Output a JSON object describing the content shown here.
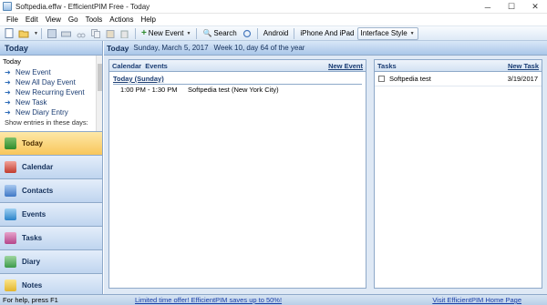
{
  "window": {
    "title": "Softpedia.effw - EfficientPIM Free - Today"
  },
  "menu": [
    "File",
    "Edit",
    "View",
    "Go",
    "Tools",
    "Actions",
    "Help"
  ],
  "toolbar": {
    "new_event_label": "New Event",
    "search_label": "Search",
    "android_label": "Android",
    "iphone_label": "iPhone And iPad",
    "interface_style_label": "Interface Style"
  },
  "left_pane": {
    "title": "Today",
    "list_heading": "Today",
    "items": [
      "New Event",
      "New All Day Event",
      "New Recurring Event",
      "New Task",
      "New Diary Entry"
    ],
    "subtext": "Show entries in these days:",
    "nav": [
      {
        "label": "Today",
        "icon": "today-icon",
        "active": true
      },
      {
        "label": "Calendar",
        "icon": "calendar-icon"
      },
      {
        "label": "Contacts",
        "icon": "contacts-icon"
      },
      {
        "label": "Events",
        "icon": "events-icon"
      },
      {
        "label": "Tasks",
        "icon": "tasks-icon"
      },
      {
        "label": "Diary",
        "icon": "diary-icon"
      },
      {
        "label": "Notes",
        "icon": "notes-icon"
      }
    ]
  },
  "main": {
    "title": "Today",
    "date_line": "Sunday, March 5, 2017",
    "week_line": "Week 10, day 64 of the year",
    "calendar_panel": {
      "heading": "Calendar  Events",
      "new_link": "New Event",
      "day_label": "Today (Sunday)",
      "events": [
        {
          "time": "1:00 PM - 1:30 PM",
          "title": "Softpedia test (New York City)"
        }
      ]
    },
    "tasks_panel": {
      "heading": "Tasks",
      "new_link": "New Task",
      "tasks": [
        {
          "name": "Softpedia test",
          "date": "3/19/2017"
        }
      ]
    }
  },
  "status": {
    "help": "For help, press F1",
    "offer": "Limited time offer! EfficientPIM saves up to 50%!",
    "home": "Visit EfficientPIM Home Page"
  },
  "colors": {
    "accent": "#a9c6e9",
    "active_nav": "#f8c65a",
    "link": "#1a3fa8"
  }
}
